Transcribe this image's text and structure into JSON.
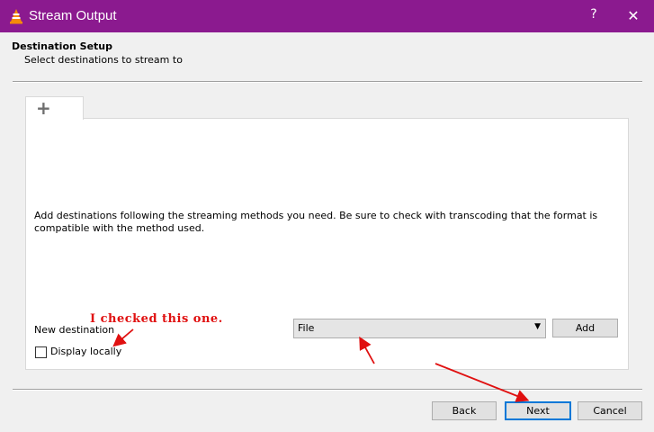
{
  "window": {
    "title": "Stream Output",
    "help_label": "?",
    "close_label": "✕",
    "app_icon": "vlc-cone-icon"
  },
  "header": {
    "title": "Destination Setup",
    "subtitle": "Select destinations to stream to"
  },
  "tabs": [
    {
      "label": "+",
      "icon": "plus-icon"
    }
  ],
  "panel": {
    "description": "Add destinations following the streaming methods you need. Be sure to check with transcoding that the format is compatible with the method used.",
    "new_destination_label": "New destination",
    "destination_select": {
      "value": "File"
    },
    "add_label": "Add",
    "display_locally": {
      "label": "Display locally",
      "checked": false
    }
  },
  "footer": {
    "back_label": "Back",
    "next_label": "Next",
    "cancel_label": "Cancel"
  },
  "annotation": {
    "text": "I checked this one.",
    "color": "#e01010"
  },
  "colors": {
    "titlebar": "#8b1a8f",
    "accent": "#0078d7"
  }
}
